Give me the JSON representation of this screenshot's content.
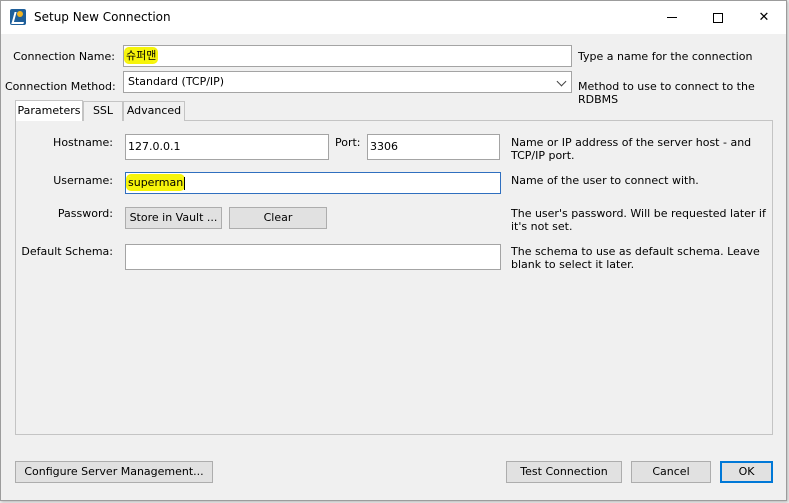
{
  "window": {
    "title": "Setup New Connection"
  },
  "connection": {
    "name_label": "Connection Name:",
    "name_value": "슈퍼맨",
    "name_hint": "Type a name for the connection",
    "method_label": "Connection Method:",
    "method_value": "Standard (TCP/IP)",
    "method_hint": "Method to use to connect to the RDBMS"
  },
  "tabs": [
    {
      "label": "Parameters",
      "active": true
    },
    {
      "label": "SSL",
      "active": false
    },
    {
      "label": "Advanced",
      "active": false
    }
  ],
  "parameters": {
    "hostname_label": "Hostname:",
    "hostname_value": "127.0.0.1",
    "port_label": "Port:",
    "port_value": "3306",
    "hostname_hint": "Name or IP address of the server host - and TCP/IP port.",
    "username_label": "Username:",
    "username_value": "superman",
    "username_hint": "Name of the user to connect with.",
    "password_label": "Password:",
    "store_vault_label": "Store in Vault ...",
    "clear_label": "Clear",
    "password_hint": "The user's password. Will be requested later if it's not set.",
    "schema_label": "Default Schema:",
    "schema_value": "",
    "schema_hint": "The schema to use as default schema. Leave blank to select it later."
  },
  "footer": {
    "configure_label": "Configure Server Management...",
    "test_label": "Test Connection",
    "cancel_label": "Cancel",
    "ok_label": "OK"
  },
  "colors": {
    "highlight": "#f6f40a",
    "focus_border": "#2f6fbf",
    "default_button_border": "#0078d7"
  }
}
